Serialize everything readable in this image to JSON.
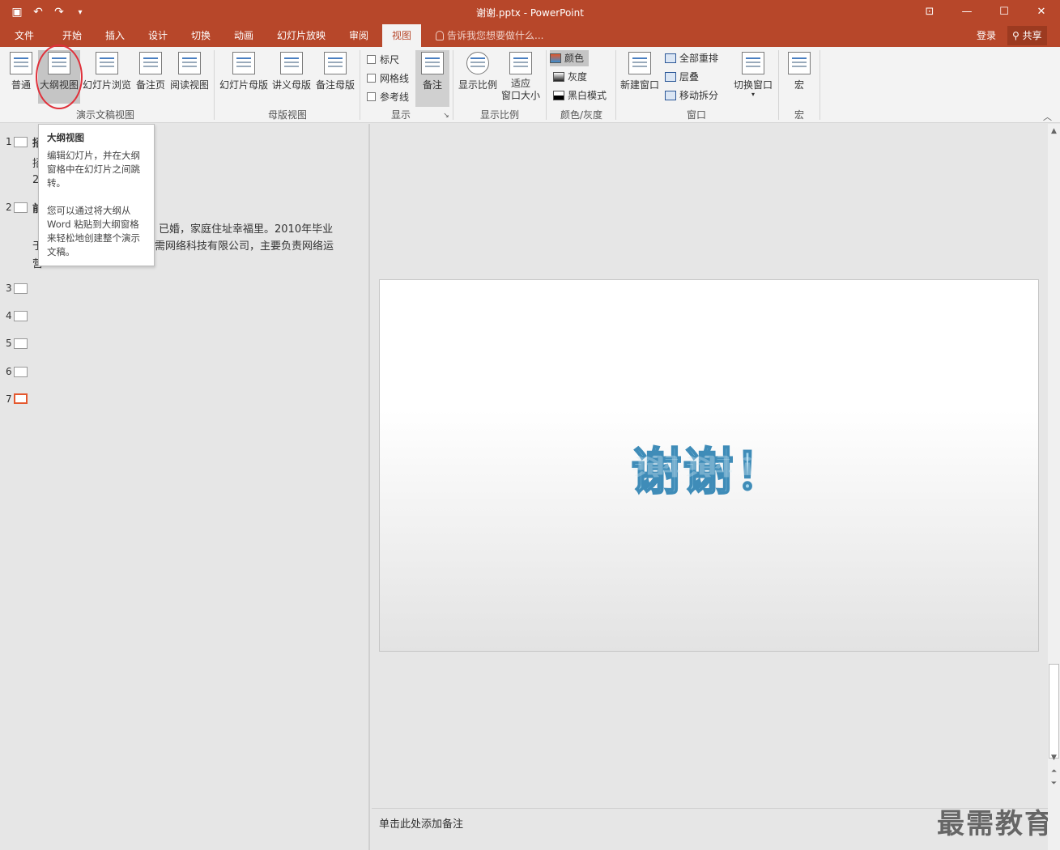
{
  "titlebar": {
    "title": "谢谢.pptx - PowerPoint",
    "qat": [
      "save-icon",
      "undo-icon",
      "redo-icon",
      "customize-icon"
    ],
    "window_buttons": [
      "ribbon-display-icon",
      "minimize-icon",
      "maximize-icon",
      "close-icon"
    ]
  },
  "tabs": [
    "文件",
    "开始",
    "插入",
    "设计",
    "切换",
    "动画",
    "幻灯片放映",
    "审阅",
    "视图"
  ],
  "active_tab": "视图",
  "tellme": "告诉我您想要做什么...",
  "login": "登录",
  "share": "共享",
  "ribbon": {
    "groups": {
      "presentation_views": "演示文稿视图",
      "master_views": "母版视图",
      "show": "显示",
      "zoom": "显示比例",
      "color": "颜色/灰度",
      "window": "窗口",
      "macros": "宏"
    },
    "buttons": {
      "normal": "普通",
      "outline": "大纲视图",
      "sorter": "幻灯片浏览",
      "notes_page": "备注页",
      "reading": "阅读视图",
      "slide_master": "幻灯片母版",
      "handout_master": "讲义母版",
      "notes_master": "备注母版",
      "notes": "备注",
      "zoom": "显示比例",
      "fit_1": "适应",
      "fit_2": "窗口大小",
      "new_window": "新建窗口",
      "switch_window": "切换窗口",
      "macros": "宏"
    },
    "checks": {
      "ruler": "标尺",
      "gridlines": "网格线",
      "guides": "参考线"
    },
    "color": {
      "color": "颜色",
      "gray": "灰度",
      "bw": "黑白模式"
    },
    "window_small": {
      "arrange_all": "全部重排",
      "cascade": "层叠",
      "move_split": "移动拆分"
    }
  },
  "tooltip": {
    "title": "大纲视图",
    "p1": "编辑幻灯片，并在大纲窗格中在幻灯片之间跳转。",
    "p2": "您可以通过将大纲从 Word 粘贴到大纲窗格来轻松地创建整个演示文稿。"
  },
  "outline": {
    "slide_numbers": [
      "1",
      "2",
      "3",
      "4",
      "5",
      "6",
      "7"
    ],
    "s1_title": "招",
    "s1_line1": "招",
    "s1_line2": "2",
    "s2_title": "前",
    "s2_line1": "已婚，家庭住址幸福里。2010年毕业",
    "s2_line2_prefix": "于",
    "s2_line2": "需网络科技有限公司，主要负责网络运",
    "s2_line3": "营"
  },
  "slide": {
    "text": "谢谢！"
  },
  "notes": "单击此处添加备注",
  "watermark": "最需教育"
}
